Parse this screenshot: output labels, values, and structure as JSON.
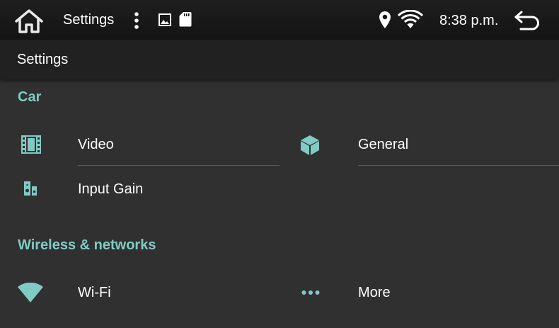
{
  "statusbar": {
    "app_title": "Settings",
    "time": "8:38 p.m."
  },
  "appbar": {
    "title": "Settings"
  },
  "sections": {
    "car": {
      "header": "Car",
      "items": [
        {
          "label": "Video",
          "icon": "film-icon"
        },
        {
          "label": "General",
          "icon": "cube-icon"
        },
        {
          "label": "Input Gain",
          "icon": "speaker-icon"
        }
      ]
    },
    "wireless": {
      "header": "Wireless & networks",
      "items": [
        {
          "label": "Wi-Fi",
          "icon": "wifi-icon"
        },
        {
          "label": "More",
          "icon": "more-dots-icon"
        }
      ]
    }
  },
  "colors": {
    "accent": "#80cbc4",
    "background": "#303030",
    "appbar": "#212121",
    "statusbar": "#181818"
  }
}
